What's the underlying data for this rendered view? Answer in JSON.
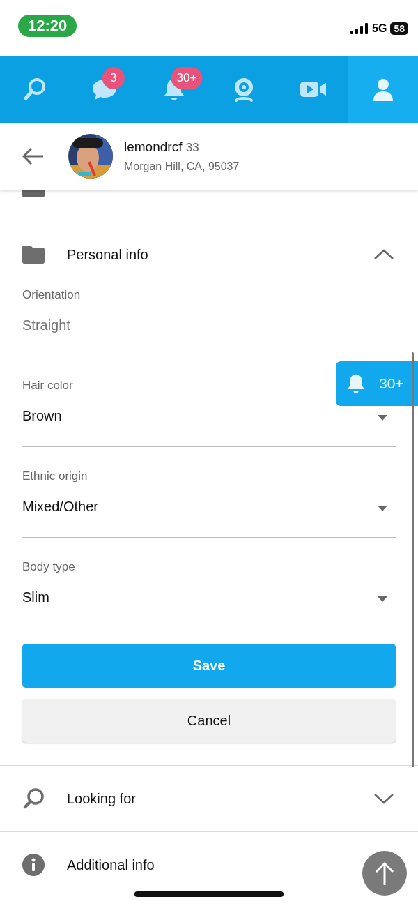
{
  "status_bar": {
    "time": "12:20",
    "network": "5G",
    "battery": "58"
  },
  "nav_tabs": [
    {
      "kind": "search",
      "selected": false
    },
    {
      "kind": "chat",
      "selected": false,
      "badge": "3"
    },
    {
      "kind": "bell",
      "selected": false,
      "badge": "30+"
    },
    {
      "kind": "webcam",
      "selected": false
    },
    {
      "kind": "video",
      "selected": false
    },
    {
      "kind": "profile",
      "selected": true
    }
  ],
  "profile": {
    "username": "lemondrcf",
    "age": "33",
    "location": "Morgan Hill, CA, 95037"
  },
  "personal_info": {
    "title": "Personal info",
    "expanded": true,
    "fields": [
      {
        "label": "Orientation",
        "value": "Straight",
        "kind": "text"
      },
      {
        "label": "Hair color",
        "value": "Brown",
        "kind": "select"
      },
      {
        "label": "Ethnic origin",
        "value": "Mixed/Other",
        "kind": "select"
      },
      {
        "label": "Body type",
        "value": "Slim",
        "kind": "select"
      }
    ],
    "buttons": [
      {
        "label": "Save",
        "kind": "primary"
      },
      {
        "label": "Cancel",
        "kind": "secondary"
      }
    ]
  },
  "sections": [
    {
      "title": "Looking for",
      "kind": "search",
      "expanded": false
    },
    {
      "title": "Additional info",
      "kind": "info"
    }
  ],
  "notification_tab": {
    "count": "30+"
  }
}
